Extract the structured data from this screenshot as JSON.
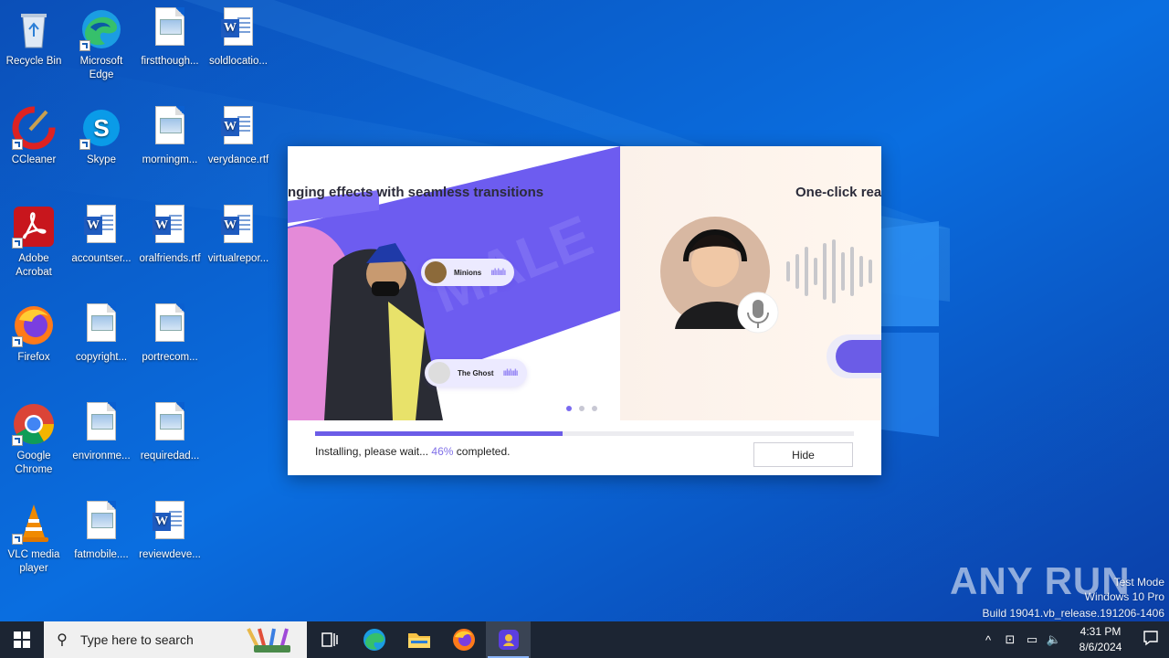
{
  "desktop": {
    "icons": [
      {
        "label": "Recycle Bin"
      },
      {
        "label": "Microsoft Edge"
      },
      {
        "label": "firstthough..."
      },
      {
        "label": "soldlocatio..."
      },
      {
        "label": "CCleaner"
      },
      {
        "label": "Skype"
      },
      {
        "label": "morningm..."
      },
      {
        "label": "verydance.rtf"
      },
      {
        "label": "Adobe Acrobat"
      },
      {
        "label": "accountser..."
      },
      {
        "label": "oralfriends.rtf"
      },
      {
        "label": "virtualrepor..."
      },
      {
        "label": "Firefox"
      },
      {
        "label": "copyright..."
      },
      {
        "label": "portrecom..."
      },
      {
        "label": "Google Chrome"
      },
      {
        "label": "environme..."
      },
      {
        "label": "requiredad..."
      },
      {
        "label": "VLC media player"
      },
      {
        "label": "fatmobile...."
      },
      {
        "label": "reviewdeve..."
      }
    ]
  },
  "installer": {
    "banner_left_title": "nging effects with seamless transitions",
    "banner_right_title": "One-click rea",
    "pill_1": "Minions",
    "pill_2": "The Ghost",
    "progress": 0.46,
    "status_prefix": "Installing, please wait... ",
    "status_percent": "46%",
    "status_suffix": " completed.",
    "hide_label": "Hide"
  },
  "watermark": {
    "logo": "ANY RUN",
    "line1": "Test Mode",
    "line2": "Windows 10 Pro",
    "line3": "Build 19041.vb_release.191206-1406"
  },
  "taskbar": {
    "search_placeholder": "Type here to search",
    "time": "4:31 PM",
    "date": "8/6/2024"
  },
  "colors": {
    "accent": "#6b5ce7",
    "taskbar": "#1c2533",
    "desktop": "#0a5fd0"
  }
}
